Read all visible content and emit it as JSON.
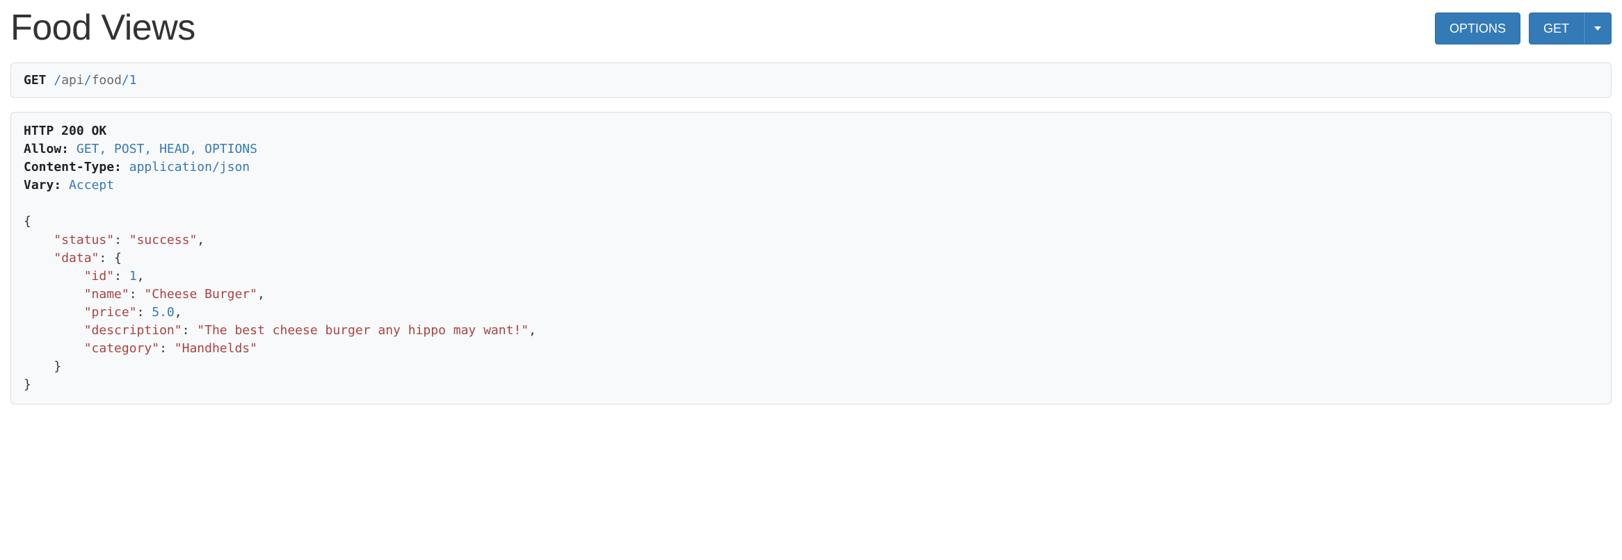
{
  "title": "Food Views",
  "buttons": {
    "options": "OPTIONS",
    "get": "GET"
  },
  "request": {
    "method": "GET",
    "path_segments": [
      "api",
      "food"
    ],
    "path_id": "1"
  },
  "response": {
    "status_line": "HTTP 200 OK",
    "headers": {
      "allow_label": "Allow:",
      "allow_value": "GET, POST, HEAD, OPTIONS",
      "content_type_label": "Content-Type:",
      "content_type_value": "application/json",
      "vary_label": "Vary:",
      "vary_value": "Accept"
    },
    "body": {
      "status_key": "\"status\"",
      "status_val": "\"success\"",
      "data_key": "\"data\"",
      "id_key": "\"id\"",
      "id_val": "1",
      "name_key": "\"name\"",
      "name_val": "\"Cheese Burger\"",
      "price_key": "\"price\"",
      "price_val": "5.0",
      "description_key": "\"description\"",
      "description_val": "\"The best cheese burger any hippo may want!\"",
      "category_key": "\"category\"",
      "category_val": "\"Handhelds\""
    }
  }
}
